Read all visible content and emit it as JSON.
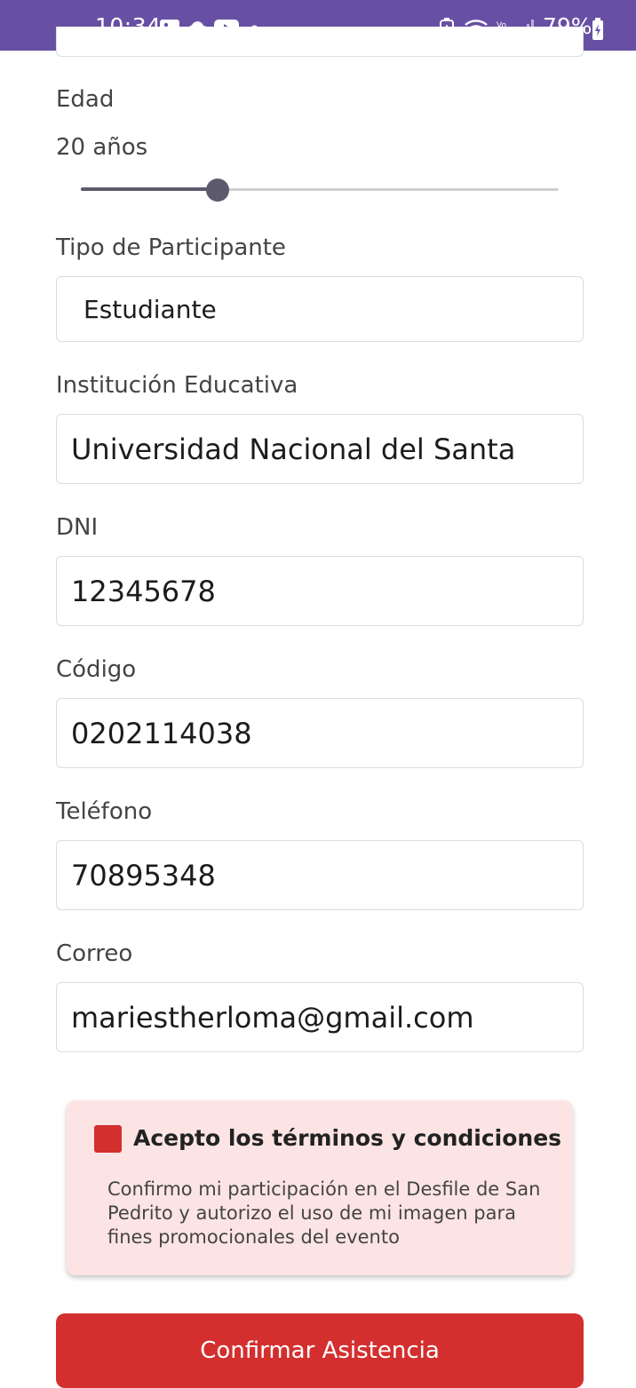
{
  "status_bar": {
    "time": "10:34",
    "battery": "79%",
    "network": "LTE",
    "icons": [
      "image-icon",
      "cloud-icon",
      "youtube-icon",
      "dot-icon",
      "battery-saver-icon",
      "wifi-icon",
      "volte-icon",
      "signal-icon",
      "battery-charging-icon"
    ],
    "background_color": "#6750a4"
  },
  "form": {
    "age": {
      "label": "Edad",
      "value_text": "20 años",
      "slider_fraction": 0.286
    },
    "participant_type": {
      "label": "Tipo de Participante",
      "value": "Estudiante"
    },
    "institution": {
      "label": "Institución Educativa",
      "value": "Universidad Nacional del Santa"
    },
    "dni": {
      "label": "DNI",
      "value": "12345678"
    },
    "code": {
      "label": "Código",
      "value": "0202114038"
    },
    "phone": {
      "label": "Teléfono",
      "value": "70895348"
    },
    "email": {
      "label": "Correo",
      "value": "mariestherloma@gmail.com"
    }
  },
  "terms": {
    "title": "Acepto los términos y condiciones",
    "description": "Confirmo mi participación en el Desfile de San Pedrito y autorizo el uso de mi imagen para fines promocionales del evento",
    "checkbox_color": "#d32f2f",
    "card_color": "#fde4e4"
  },
  "confirm_button": {
    "label": "Confirmar Asistencia",
    "color": "#d32f2f"
  }
}
